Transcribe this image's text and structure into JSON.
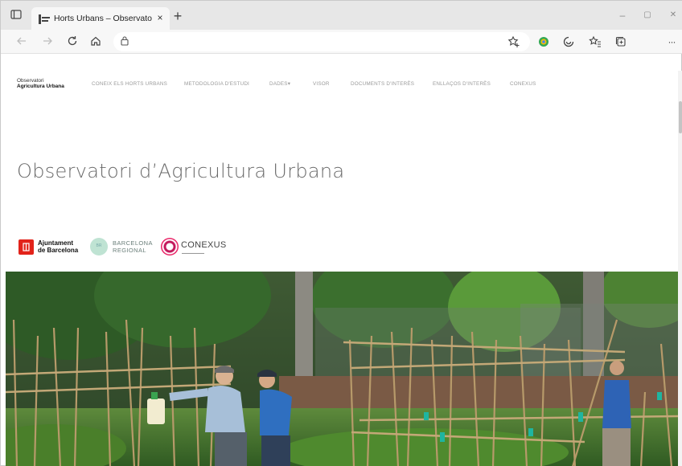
{
  "browser": {
    "tab_title": "Horts Urbans – Observatori d'ag",
    "close_glyph": "×",
    "new_tab_glyph": "+",
    "minimize_glyph": "–",
    "maximize_glyph": "▢",
    "close_window_glyph": "✕",
    "more_glyph": "···",
    "address_value": "",
    "icons": {
      "tab_actions": "tab-actions-icon",
      "back": "back-arrow-icon",
      "forward": "forward-arrow-icon",
      "refresh": "refresh-icon",
      "home": "home-icon",
      "lock": "lock-icon",
      "favorite_add": "favorite-add-icon",
      "extensions": [
        "extension-icon",
        "extension-icon"
      ],
      "favorites": "favorites-icon",
      "collections": "collections-icon",
      "more": "more-icon"
    }
  },
  "site": {
    "brand": {
      "line1": "Observatori",
      "line2": "Agricultura Urbana"
    },
    "nav": [
      {
        "label": "CONEIX ELS HORTS URBANS"
      },
      {
        "label": "METODOLOGIA D'ESTUDI"
      },
      {
        "label": "DADES▾"
      },
      {
        "label": "VISOR"
      },
      {
        "label": "DOCUMENTS D'INTERÈS"
      },
      {
        "label": "ENLLAÇOS D'INTERÈS"
      },
      {
        "label": "CONEXUS"
      }
    ],
    "hero_title": "Observatori d’Agricultura Urbana",
    "logos": {
      "ajuntament": {
        "line1": "Ajuntament",
        "line2": "de Barcelona"
      },
      "barcelona_regional": {
        "line1": "BARCELONA",
        "line2": "REGIONAL"
      },
      "conexus": {
        "name": "CONEXUS"
      }
    },
    "photo_alt": "Gent gran treballant en un hort urbà"
  },
  "colors": {
    "ajuntament_red": "#e2231a",
    "title_gray": "#6a6a6a",
    "nav_gray": "#9a9a9a",
    "conexus_pink": "#c2185b"
  }
}
